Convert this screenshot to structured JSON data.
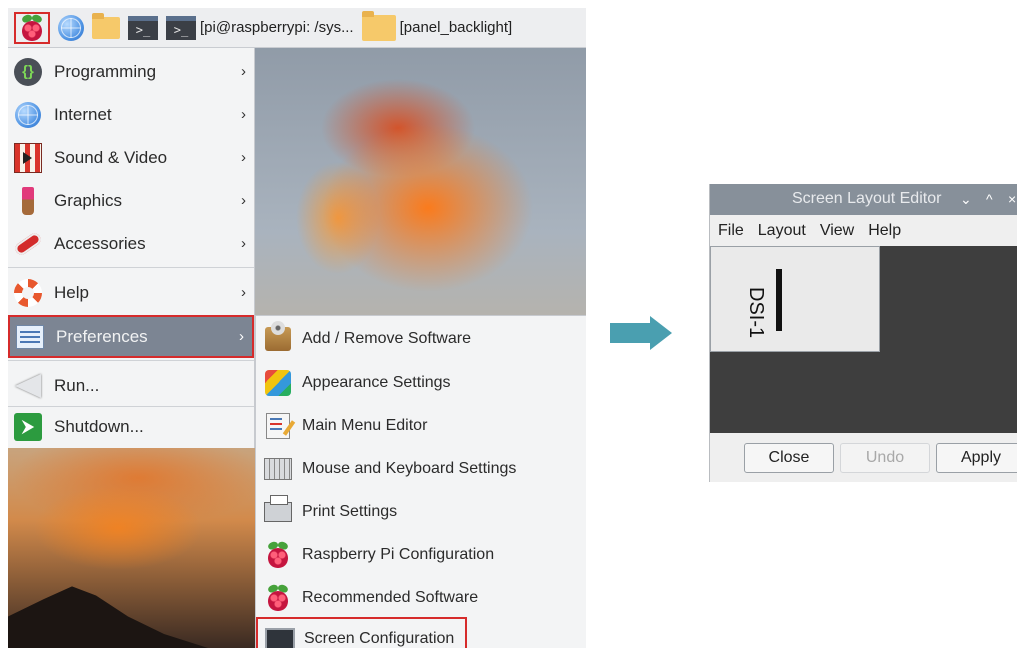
{
  "taskbar": {
    "tasks": [
      {
        "label": "[pi@raspberrypi: /sys..."
      },
      {
        "label": "[panel_backlight]"
      }
    ]
  },
  "main_menu": {
    "items": [
      {
        "label": "Programming",
        "icon": "programming-icon",
        "has_submenu": true
      },
      {
        "label": "Internet",
        "icon": "globe-icon",
        "has_submenu": true
      },
      {
        "label": "Sound & Video",
        "icon": "sound-video-icon",
        "has_submenu": true
      },
      {
        "label": "Graphics",
        "icon": "paintbrush-icon",
        "has_submenu": true
      },
      {
        "label": "Accessories",
        "icon": "accessories-icon",
        "has_submenu": true
      },
      {
        "label": "Help",
        "icon": "lifebuoy-icon",
        "has_submenu": true
      },
      {
        "label": "Preferences",
        "icon": "preferences-icon",
        "has_submenu": true,
        "selected": true
      },
      {
        "label": "Run...",
        "icon": "run-icon",
        "has_submenu": false
      },
      {
        "label": "Shutdown...",
        "icon": "shutdown-icon",
        "has_submenu": false
      }
    ],
    "chevron": "›"
  },
  "preferences_submenu": {
    "items": [
      {
        "label": "Add / Remove Software",
        "icon": "add-remove-software-icon"
      },
      {
        "label": "Appearance Settings",
        "icon": "appearance-settings-icon"
      },
      {
        "label": "Main Menu Editor",
        "icon": "main-menu-editor-icon"
      },
      {
        "label": "Mouse and Keyboard Settings",
        "icon": "keyboard-icon"
      },
      {
        "label": "Print Settings",
        "icon": "printer-icon"
      },
      {
        "label": "Raspberry Pi Configuration",
        "icon": "raspberry-icon"
      },
      {
        "label": "Recommended Software",
        "icon": "raspberry-icon"
      },
      {
        "label": "Screen Configuration",
        "icon": "monitor-icon",
        "highlighted": true
      }
    ]
  },
  "screen_layout_editor": {
    "title": "Screen Layout Editor",
    "controls": {
      "minimize": "⌄",
      "maximize": "^",
      "close": "×"
    },
    "menu": [
      "File",
      "Layout",
      "View",
      "Help"
    ],
    "display_label": "DSI-1",
    "buttons": {
      "close": "Close",
      "undo": "Undo",
      "apply": "Apply"
    }
  },
  "colors": {
    "highlight_border": "#d62b2b",
    "selected_bg": "#7c8593",
    "arrow": "#4a9fb0",
    "titlebar": "#87909a",
    "canvas": "#3e3e3e"
  }
}
